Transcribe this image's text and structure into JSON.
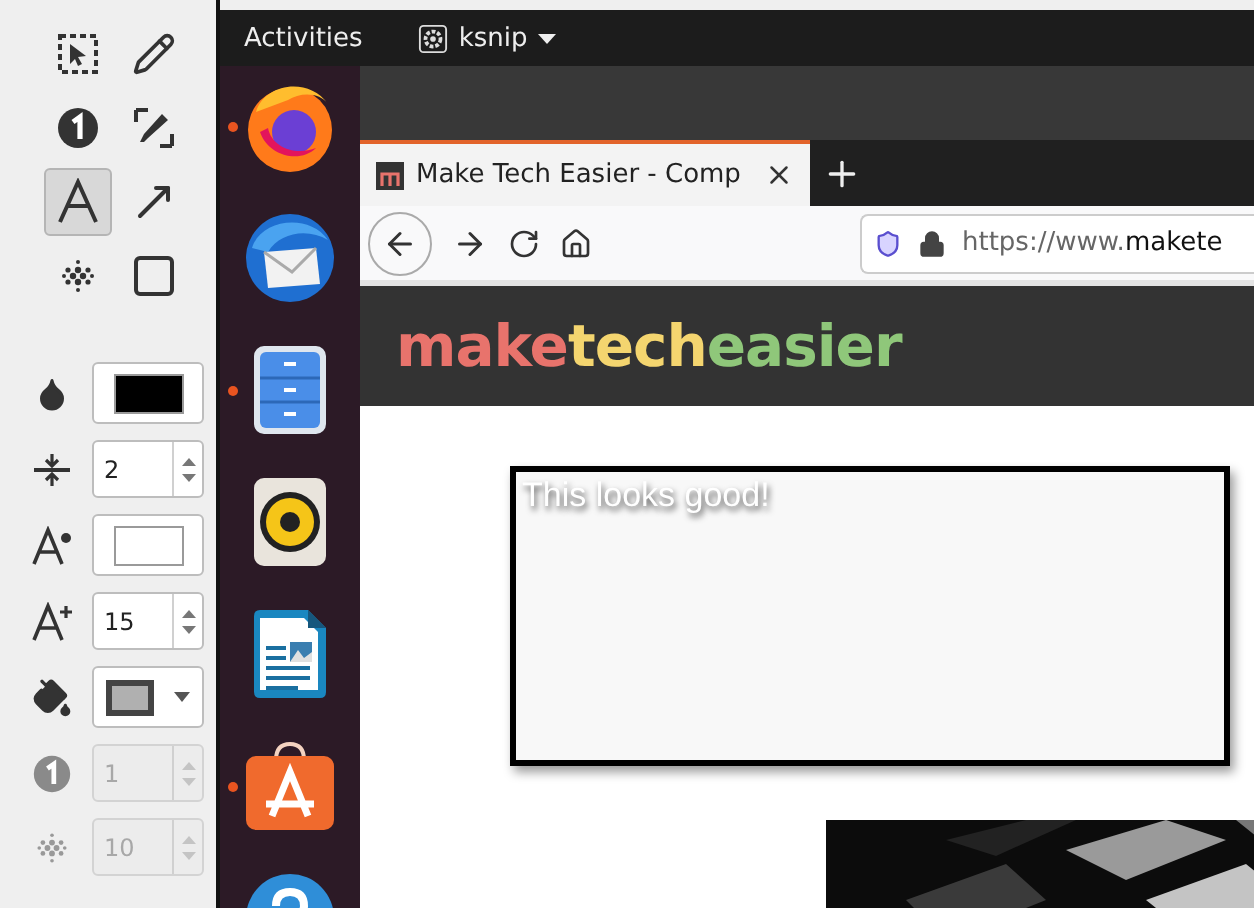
{
  "tools": [
    {
      "kind": "select",
      "selected": false
    },
    {
      "kind": "pen",
      "selected": false
    },
    {
      "kind": "number",
      "selected": false
    },
    {
      "kind": "marker",
      "selected": false
    },
    {
      "kind": "text",
      "selected": true
    },
    {
      "kind": "arrow",
      "selected": false
    },
    {
      "kind": "blur",
      "selected": false
    },
    {
      "kind": "rect",
      "selected": false
    }
  ],
  "properties": [
    {
      "kind": "color",
      "color": "#000000"
    },
    {
      "kind": "width",
      "value": "2",
      "disabled": false
    },
    {
      "kind": "font-color",
      "color": "#ffffff"
    },
    {
      "kind": "font-size",
      "value": "15",
      "disabled": false
    },
    {
      "kind": "fill"
    },
    {
      "kind": "number",
      "value": "1",
      "disabled": true
    },
    {
      "kind": "blur",
      "value": "10",
      "disabled": true
    }
  ],
  "top_bar": {
    "activities": "Activities",
    "app": "ksnip"
  },
  "dock": [
    {
      "kind": "firefox",
      "running": true
    },
    {
      "kind": "mail",
      "running": false
    },
    {
      "kind": "files",
      "running": true
    },
    {
      "kind": "music",
      "running": false
    },
    {
      "kind": "writer",
      "running": false
    },
    {
      "kind": "store",
      "running": true
    },
    {
      "kind": "help",
      "running": false
    }
  ],
  "browser": {
    "tab_title": "Make Tech Easier - Comp",
    "url": "https://www.**makete**",
    "logo": [
      {
        "text": "make",
        "color": "#e8736c"
      },
      {
        "text": "tech",
        "color": "#f4d56f"
      },
      {
        "text": "easier",
        "color": "#8fc77a"
      }
    ],
    "annotation": "This looks good!"
  }
}
